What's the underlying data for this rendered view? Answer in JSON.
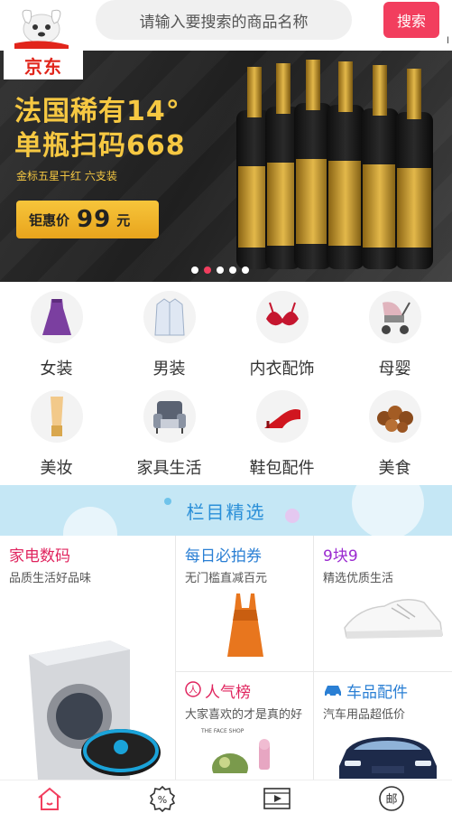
{
  "header": {
    "logo": "jd-dog-logo",
    "search_placeholder": "请输入要搜索的商品名称",
    "search_button": "搜索",
    "edge_char": "l"
  },
  "banner": {
    "brand_tag": "京东",
    "title_line1": "法国稀有14°",
    "title_line2": "单瓶扫码668",
    "subtitle": "金标五星干红  六支装",
    "price_label": "钜惠价",
    "price_value": "99",
    "price_unit": "元",
    "slide_count": 5,
    "active_slide": 2
  },
  "categories": [
    {
      "label": "女装",
      "icon": "dress-icon"
    },
    {
      "label": "男装",
      "icon": "shirt-icon"
    },
    {
      "label": "内衣配饰",
      "icon": "bra-icon"
    },
    {
      "label": "母婴",
      "icon": "stroller-icon"
    },
    {
      "label": "美妆",
      "icon": "cosmetic-tube-icon"
    },
    {
      "label": "家具生活",
      "icon": "armchair-icon"
    },
    {
      "label": "鞋包配件",
      "icon": "high-heel-icon"
    },
    {
      "label": "美食",
      "icon": "nuts-icon"
    }
  ],
  "section": {
    "title": "栏目精选"
  },
  "features": {
    "appliances": {
      "title": "家电数码",
      "subtitle": "品质生活好品味"
    },
    "daily": {
      "title": "每日必拍券",
      "subtitle": "无门槛直减百元"
    },
    "nine": {
      "title": "9块9",
      "subtitle": "精选优质生活"
    },
    "popular": {
      "title": "人气榜",
      "subtitle": "大家喜欢的才是真的好",
      "brand_caption": "THE FACE SHOP"
    },
    "car": {
      "title": "车品配件",
      "subtitle": "汽车用品超低价"
    }
  },
  "bottom_nav": [
    {
      "icon": "home-icon"
    },
    {
      "icon": "discount-icon"
    },
    {
      "icon": "video-icon"
    },
    {
      "icon": "mail-icon",
      "glyph": "邮"
    }
  ],
  "colors": {
    "accent": "#f23e5e",
    "banner_gold": "#f6c842",
    "section_bg": "#c5e7f5",
    "section_title": "#2a8fd8"
  }
}
